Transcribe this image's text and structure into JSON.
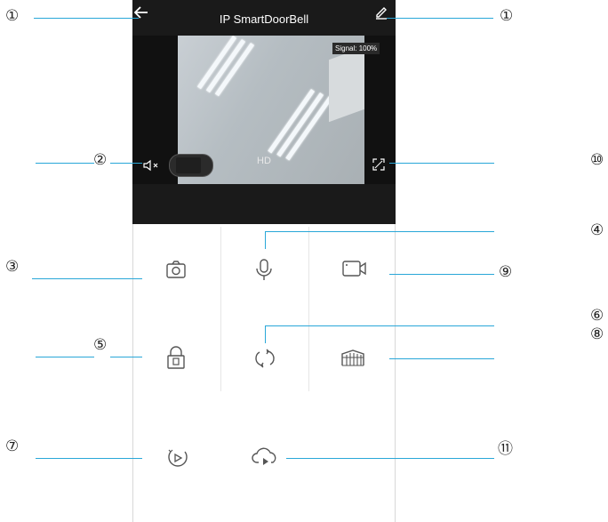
{
  "header": {
    "title": "IP SmartDoorBell",
    "back_icon": "arrow-left-icon",
    "edit_icon": "edit-pencil-icon"
  },
  "video": {
    "signal_label": "Signal:",
    "signal_value": "100%",
    "quality_label": "HD",
    "mute_icon": "speaker-muted-icon",
    "fullscreen_icon": "fullscreen-icon"
  },
  "controls": [
    {
      "name": "snapshot",
      "icon": "camera-icon"
    },
    {
      "name": "talk",
      "icon": "microphone-icon"
    },
    {
      "name": "record",
      "icon": "video-camera-icon"
    },
    {
      "name": "unlock",
      "icon": "lock-icon"
    },
    {
      "name": "rotate",
      "icon": "refresh-icon"
    },
    {
      "name": "gate",
      "icon": "gate-icon"
    },
    {
      "name": "playback",
      "icon": "playback-icon"
    },
    {
      "name": "cloud",
      "icon": "cloud-play-icon"
    }
  ],
  "callouts": {
    "c1_left": "①",
    "c1_right": "①",
    "c2": "②",
    "c3": "③",
    "c4": "④",
    "c5": "⑤",
    "c6": "⑥",
    "c7": "⑦",
    "c8": "⑧",
    "c9": "⑨",
    "c10": "⑩",
    "c11": "⑪"
  },
  "colors": {
    "callout_line": "#29a7d8",
    "header_bg": "#1a1a1a",
    "icon_stroke": "#555555"
  }
}
